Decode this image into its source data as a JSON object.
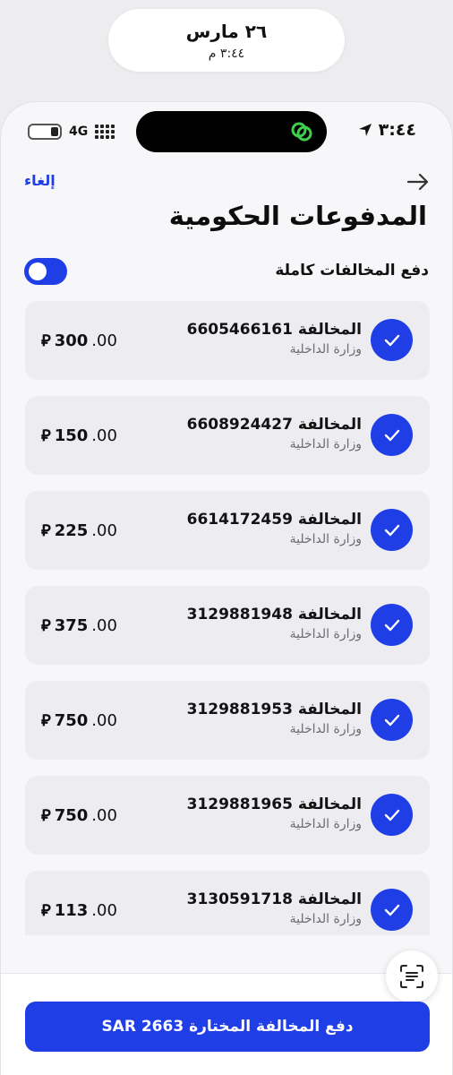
{
  "notification": {
    "date": "٢٦ مارس",
    "time": "٣:٤٤ م"
  },
  "statusbar": {
    "time": "٣:٤٤",
    "network": "4G",
    "location_icon": "location-arrow-icon",
    "island_icon": "chat-link-icon"
  },
  "header": {
    "cancel_label": "إلغاء",
    "back_icon": "arrow-right-icon",
    "title": "المدفوعات الحكومية"
  },
  "toggle": {
    "label": "دفع المخالفات كاملة",
    "state": "on"
  },
  "violations": [
    {
      "title": "المخالفة 6605466161",
      "issuer": "وزارة الداخلية",
      "amount_int": "300",
      "amount_dec": ".00",
      "currency": "⃁"
    },
    {
      "title": "المخالفة 6608924427",
      "issuer": "وزارة الداخلية",
      "amount_int": "150",
      "amount_dec": ".00",
      "currency": "⃁"
    },
    {
      "title": "المخالفة 6614172459",
      "issuer": "وزارة الداخلية",
      "amount_int": "225",
      "amount_dec": ".00",
      "currency": "⃁"
    },
    {
      "title": "المخالفة 3129881948",
      "issuer": "وزارة الداخلية",
      "amount_int": "375",
      "amount_dec": ".00",
      "currency": "⃁"
    },
    {
      "title": "المخالفة 3129881953",
      "issuer": "وزارة الداخلية",
      "amount_int": "750",
      "amount_dec": ".00",
      "currency": "⃁"
    },
    {
      "title": "المخالفة 3129881965",
      "issuer": "وزارة الداخلية",
      "amount_int": "750",
      "amount_dec": ".00",
      "currency": "⃁"
    },
    {
      "title": "المخالفة 3130591718",
      "issuer": "وزارة الداخلية",
      "amount_int": "113",
      "amount_dec": ".00",
      "currency": "⃁"
    }
  ],
  "footer": {
    "pay_label": "دفع المخالفة المختارة SAR 2663",
    "scan_icon": "text-scan-icon"
  },
  "colors": {
    "accent": "#1f3ee6",
    "card": "#ececf1",
    "background": "#f7f7f9"
  }
}
